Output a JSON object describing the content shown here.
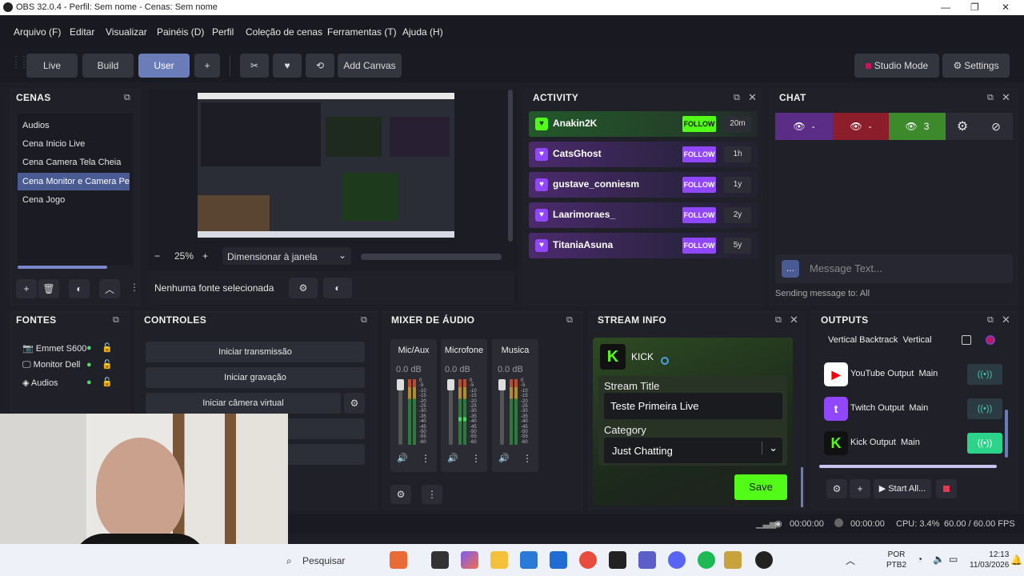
{
  "window": {
    "title": "OBS 32.0.4 - Perfil: Sem nome - Cenas: Sem nome",
    "min": "—",
    "max": "❐",
    "close": "✕"
  },
  "menu": [
    "Arquivo (F)",
    "Editar",
    "Visualizar",
    "Painéis (D)",
    "Perfil",
    "Coleção de cenas",
    "Ferramentas (T)",
    "Ajuda (H)"
  ],
  "toolbar": {
    "live": "Live",
    "build": "Build",
    "user": "User",
    "plus": "+",
    "add_canvas": "Add Canvas",
    "studio_mode": "Studio Mode",
    "settings": "Settings"
  },
  "scenes": {
    "title": "CENAS",
    "items": [
      "Audios",
      "Cena Inicio Live",
      "Cena Camera Tela Cheia",
      "Cena Monitor e Camera Peq",
      "Cena Jogo"
    ],
    "selected_index": 3
  },
  "preview": {
    "zoom": "25%",
    "minus": "−",
    "plus": "+",
    "scale_mode": "Dimensionar à janela",
    "no_source": "Nenhuma fonte selecionada"
  },
  "activity": {
    "title": "ACTIVITY",
    "follow_label": "FOLLOW",
    "items": [
      {
        "name": "Anakin2K",
        "ago": "20m"
      },
      {
        "name": "CatsGhost",
        "ago": "1h"
      },
      {
        "name": "gustave_conniesm",
        "ago": "1y"
      },
      {
        "name": "Laarimoraes_",
        "ago": "2y"
      },
      {
        "name": "TitaniaAsuna",
        "ago": "5y"
      }
    ]
  },
  "chat": {
    "title": "CHAT",
    "counts": [
      "-",
      "-",
      "3"
    ],
    "placeholder": "Message Text...",
    "sending_to": "Sending message to: All"
  },
  "sources": {
    "title": "FONTES",
    "items": [
      "Emmet S600",
      "Monitor Dell",
      "Audios"
    ]
  },
  "controls": {
    "title": "CONTROLES",
    "start_stream": "Iniciar transmissão",
    "start_record": "Iniciar gravação",
    "start_virtualcam": "Iniciar câmera virtual"
  },
  "mixer": {
    "title": "MIXER DE ÁUDIO",
    "channels": [
      {
        "name": "Mic/Aux",
        "db": "0.0 dB"
      },
      {
        "name": "Microfone",
        "db": "0.0 dB"
      },
      {
        "name": "Musica",
        "db": "0.0 dB"
      }
    ],
    "scale": [
      "0",
      "-5",
      "-10",
      "-15",
      "-20",
      "-25",
      "-30",
      "-35",
      "-40",
      "-45",
      "-50",
      "-55",
      "-60"
    ]
  },
  "stream_info": {
    "title": "STREAM INFO",
    "platform": "KICK",
    "title_label": "Stream Title",
    "title_value": "Teste Primeira Live",
    "category_label": "Category",
    "category_value": "Just Chatting",
    "save": "Save"
  },
  "outputs": {
    "title": "OUTPUTS",
    "items": [
      {
        "name": "Vertical Backtrack",
        "target": "Vertical"
      },
      {
        "name": "YouTube Output",
        "target": "Main"
      },
      {
        "name": "Twitch Output",
        "target": "Main"
      },
      {
        "name": "Kick Output",
        "target": "Main"
      }
    ],
    "start_all": "Start All..."
  },
  "status": {
    "stream_time": "00:00:00",
    "record_time": "00:00:00",
    "cpu": "CPU: 3.4%",
    "fps": "60.00 / 60.00 FPS"
  },
  "taskbar": {
    "search": "Pesquisar",
    "lang": "POR",
    "layout": "PTB2",
    "time": "12:13",
    "date": "11/03/2026"
  },
  "colors": {
    "kick": "#53fc18",
    "twitch": "#9147ff",
    "youtube": "#ff0000",
    "accent": "#4a5b94"
  }
}
